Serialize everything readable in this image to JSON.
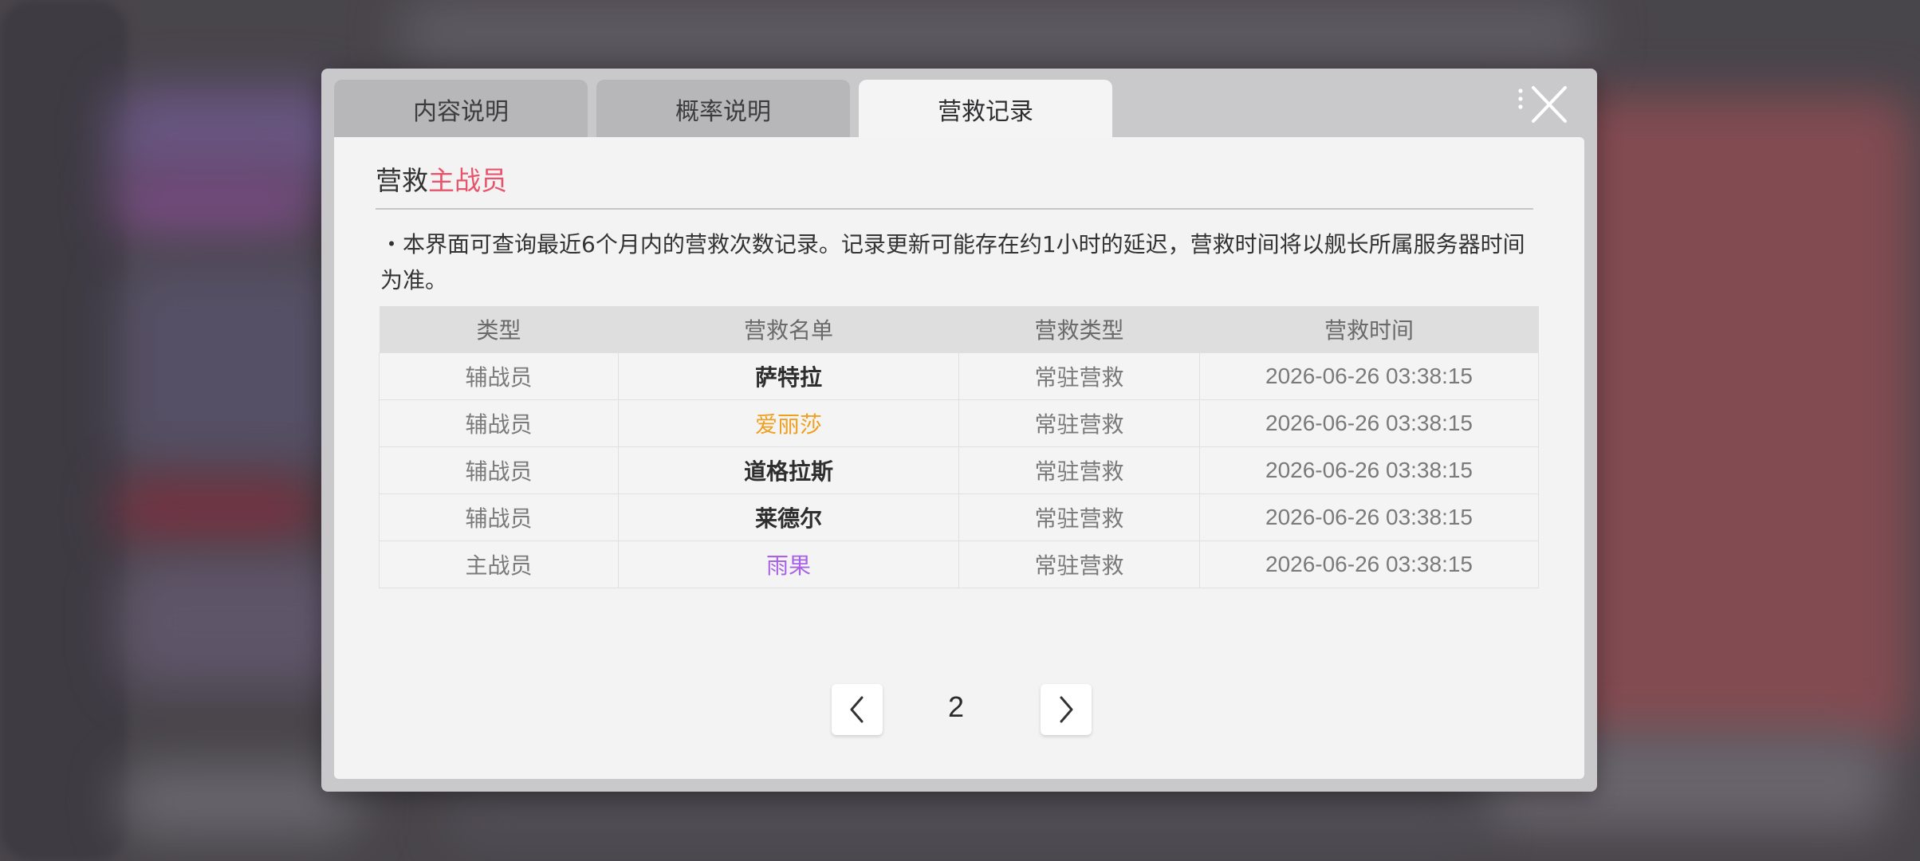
{
  "tabs": [
    {
      "label": "内容说明",
      "active": false
    },
    {
      "label": "概率说明",
      "active": false
    },
    {
      "label": "营救记录",
      "active": true
    }
  ],
  "section_title": {
    "prefix": "营救",
    "highlight": "主战员"
  },
  "notice": "・本界面可查询最近6个月内的营救次数记录。记录更新可能存在约1小时的延迟，营救时间将以舰长所属服务器时间为准。",
  "table": {
    "headers": [
      "类型",
      "营救名单",
      "营救类型",
      "营救时间"
    ],
    "rows": [
      {
        "type": "辅战员",
        "name": "萨特拉",
        "rescue_type": "常驻营救",
        "time": "2026-06-26 03:38:15",
        "name_color": "#2e2e2e"
      },
      {
        "type": "辅战员",
        "name": "爱丽莎",
        "rescue_type": "常驻营救",
        "time": "2026-06-26 03:38:15",
        "name_color": "#f0a020"
      },
      {
        "type": "辅战员",
        "name": "道格拉斯",
        "rescue_type": "常驻营救",
        "time": "2026-06-26 03:38:15",
        "name_color": "#2e2e2e"
      },
      {
        "type": "辅战员",
        "name": "莱德尔",
        "rescue_type": "常驻营救",
        "time": "2026-06-26 03:38:15",
        "name_color": "#2e2e2e"
      },
      {
        "type": "主战员",
        "name": "雨果",
        "rescue_type": "常驻营救",
        "time": "2026-06-26 03:38:15",
        "name_color": "#a862e6"
      }
    ]
  },
  "pagination": {
    "current_page": "2",
    "prev_icon": "chevron-left-icon",
    "next_icon": "chevron-right-icon"
  },
  "colors": {
    "accent": "#e8546b",
    "gold": "#f0a020",
    "purple": "#a862e6"
  },
  "icons": {
    "close": "close-icon"
  }
}
